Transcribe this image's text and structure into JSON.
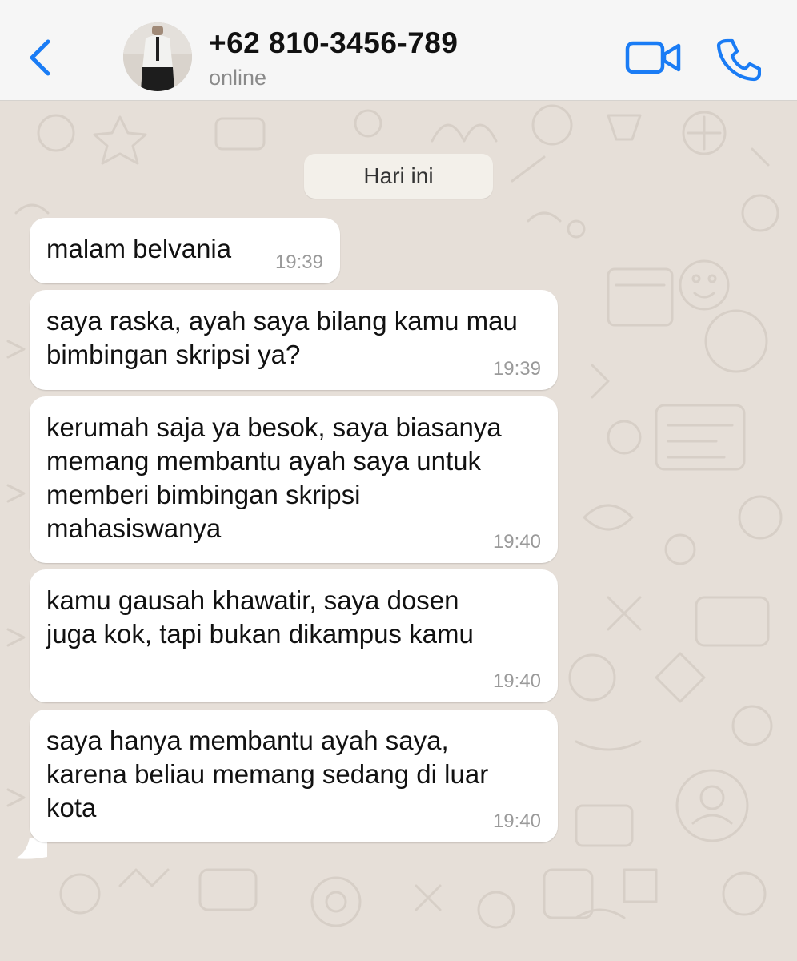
{
  "header": {
    "back_icon": "chevron-left-icon",
    "contact_name": "+62 810-3456-789",
    "status": "online",
    "video_icon": "video-camera-icon",
    "call_icon": "phone-icon",
    "accent_color": "#1a7cf5"
  },
  "chat": {
    "date_label": "Hari ini",
    "messages": [
      {
        "text": "malam belvania",
        "time": "19:39"
      },
      {
        "text": "saya raska, ayah saya bilang kamu mau\nbimbingan skripsi ya?",
        "time": "19:39"
      },
      {
        "text": "kerumah saja ya besok, saya biasanya\nmemang membantu ayah saya untuk\nmemberi bimbingan skripsi\nmahasiswanya",
        "time": "19:40"
      },
      {
        "text": "kamu gausah khawatir, saya dosen\njuga kok, tapi bukan dikampus kamu",
        "time": "19:40"
      },
      {
        "text": "saya hanya membantu ayah saya,\nkarena beliau memang sedang di luar\nkota",
        "time": "19:40"
      }
    ]
  },
  "colors": {
    "wallpaper": "#e6dfd8",
    "bubble": "#ffffff",
    "header_bg": "#f6f6f6"
  }
}
